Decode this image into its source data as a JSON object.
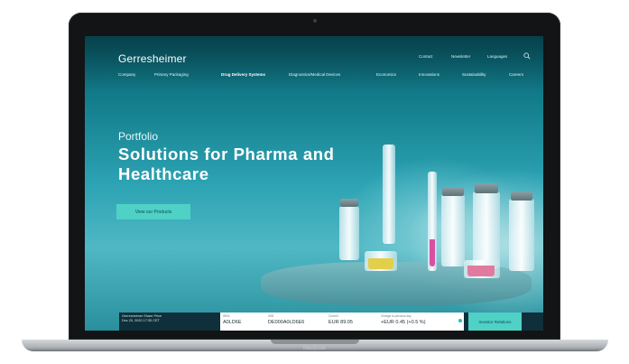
{
  "device": {
    "brand": "MacBook"
  },
  "header": {
    "logo": "Gerresheimer",
    "utility": [
      "Contact",
      "Newsletter",
      "Languages"
    ],
    "search_icon": "search-icon"
  },
  "nav": {
    "items": [
      "Company",
      "Primary Packaging",
      "Drug Delivery Systems",
      "Diagnostics/Medical Devices",
      "Economics",
      "Innovations",
      "Sustainability",
      "Careers"
    ],
    "active_index": 2
  },
  "hero": {
    "eyebrow": "Portfolio",
    "headline": "Solutions for Pharma and Healthcare",
    "cta": "View our Products"
  },
  "share": {
    "title": "Gerresheimer Share Price",
    "timestamp": "Dec 20, 2020 17:35 CET",
    "wkn_label": "WKN",
    "wkn": "A0LD6E",
    "isin_label": "ISIN",
    "isin": "DE000A0LD6E6",
    "price_label": "Current",
    "price": "EUR 89.05",
    "change_label": "Change to previous day",
    "change": "+EUR 0.45 (+0.5 %)",
    "investor_button": "Investor Relations"
  },
  "colors": {
    "accent": "#4fd1c6",
    "bar": "#0f2f3a",
    "hero_dark": "#0b5f6c"
  }
}
